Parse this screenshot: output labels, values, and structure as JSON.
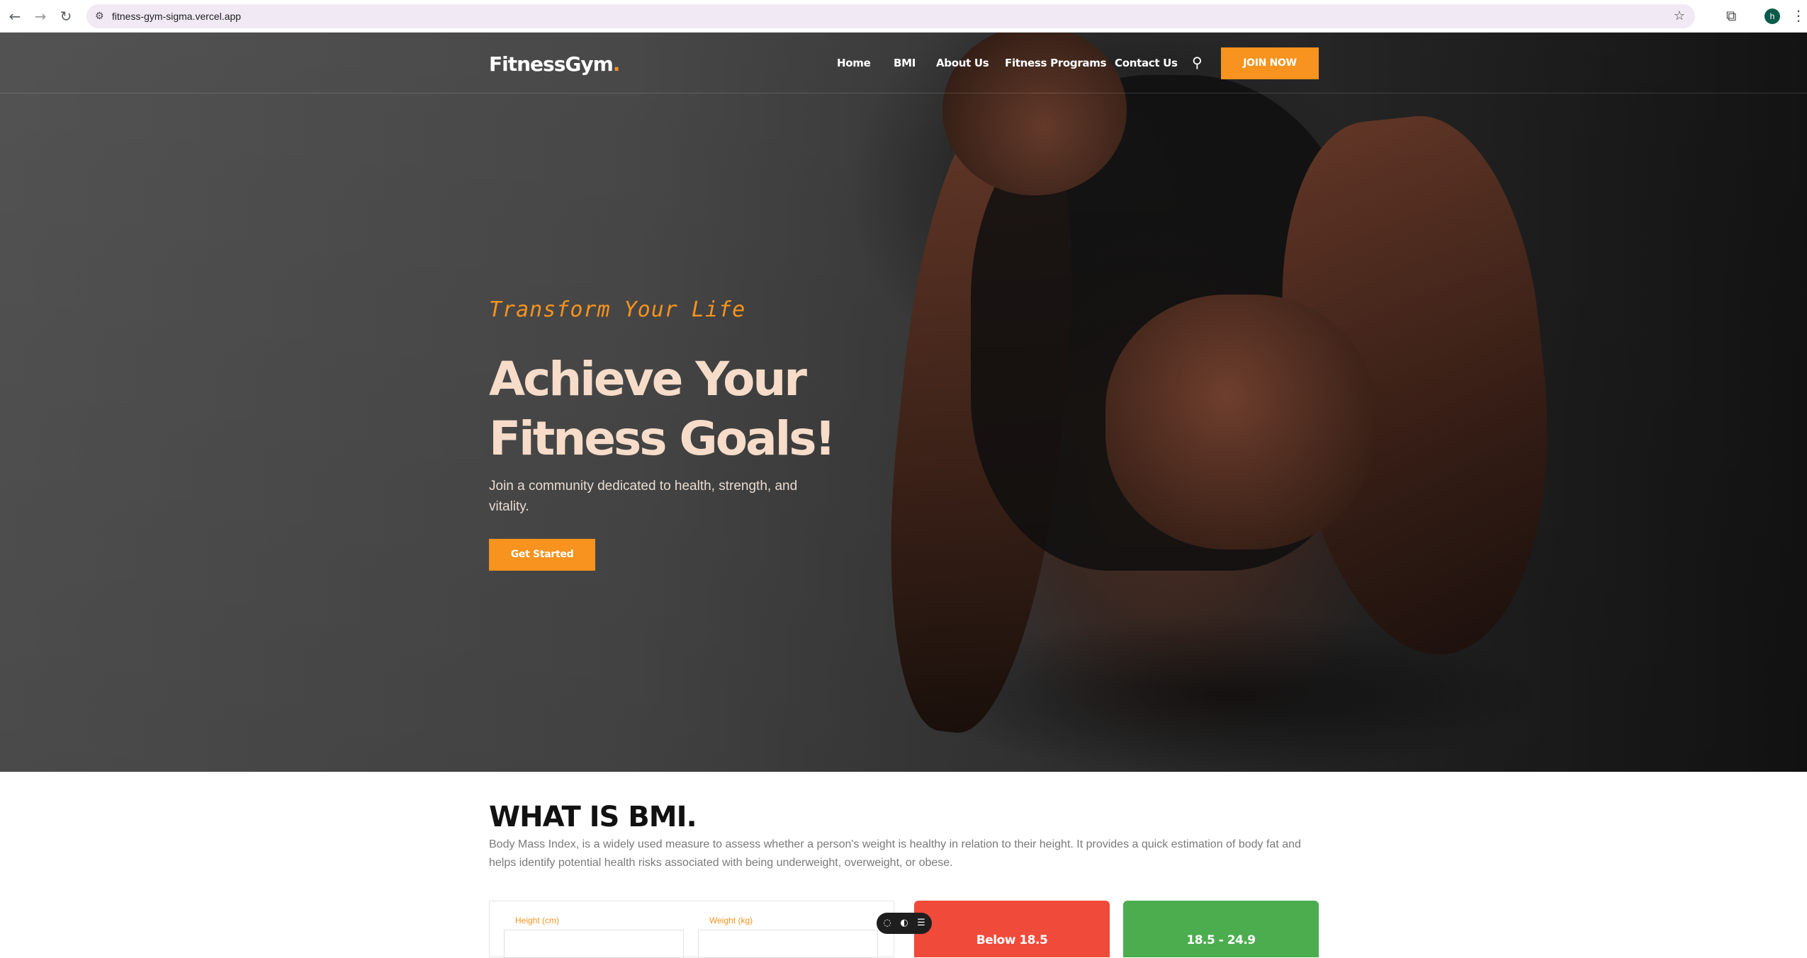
{
  "browser": {
    "url": "fitness-gym-sigma.vercel.app",
    "back_icon": "back-arrow-icon",
    "forward_icon": "forward-arrow-icon",
    "reload_icon": "reload-icon",
    "profile_initial": "h"
  },
  "header": {
    "logo_text": "FitnessGym",
    "logo_dot": ".",
    "nav": [
      "Home",
      "BMI",
      "About Us",
      "Fitness Programs",
      "Contact Us"
    ],
    "join_label": "JOIN NOW"
  },
  "hero": {
    "tagline": "Transform Your Life",
    "headline_line1": "Achieve Your",
    "headline_line2": "Fitness Goals!",
    "subtext": "Join a community dedicated to health, strength, and vitality.",
    "cta_label": "Get Started"
  },
  "bmi": {
    "title": "WHAT IS BMI.",
    "description": "Body Mass Index, is a widely used measure to assess whether a person's weight is healthy in relation to their height. It provides a quick estimation of body fat and helps identify potential health risks associated with being underweight, overweight, or obese.",
    "height_label": "Height (cm)",
    "weight_label": "Weight (kg)",
    "ranges": [
      "Below 18.5",
      "18.5 - 24.9"
    ]
  },
  "colors": {
    "accent": "#f7931e",
    "underweight": "#f04a3a",
    "normal": "#4cad4f"
  }
}
